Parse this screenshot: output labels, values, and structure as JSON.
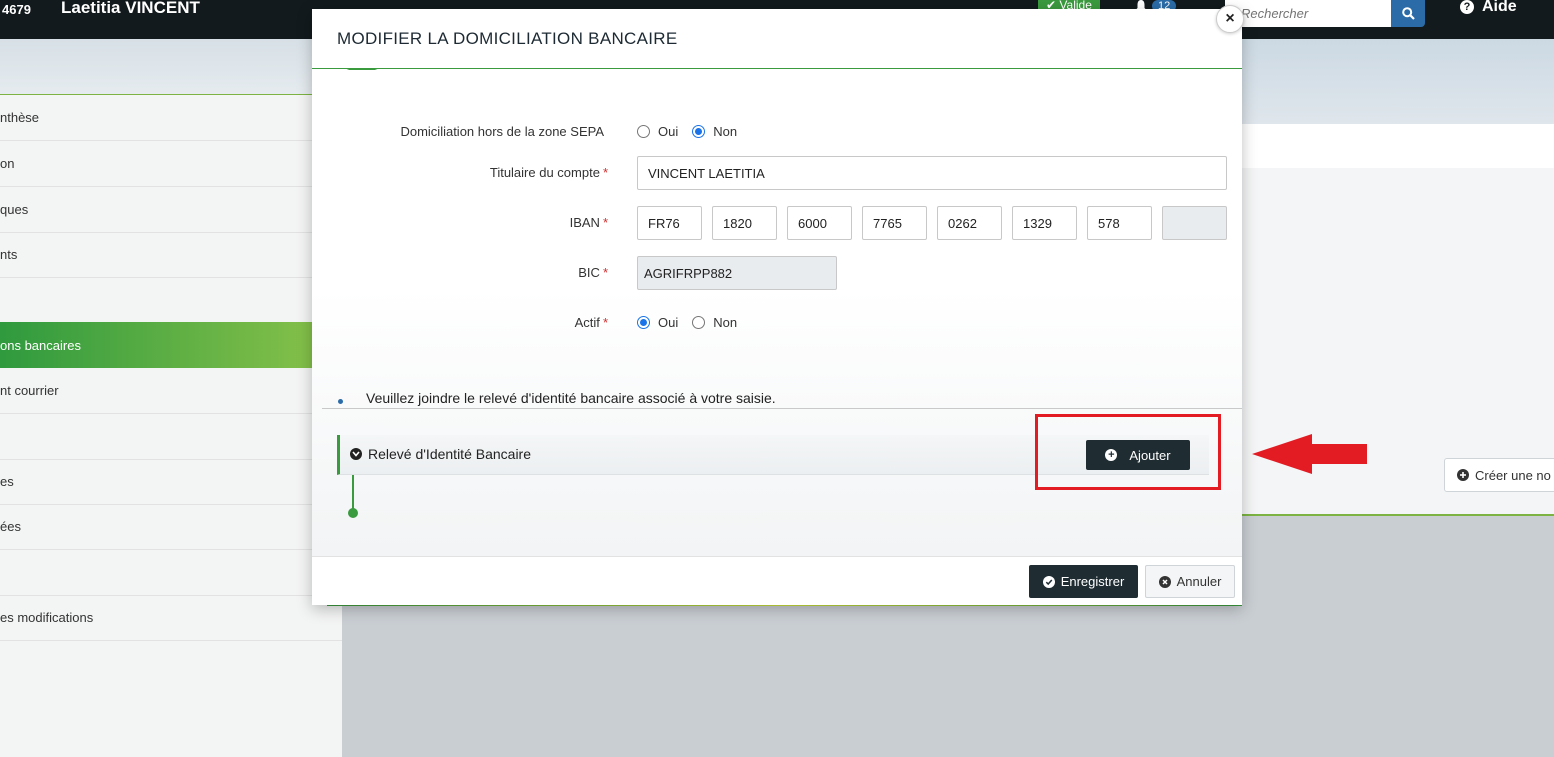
{
  "topbar": {
    "user_id": "4679",
    "user_name": "Laetitia VINCENT",
    "status_badge": "Valide",
    "notification_count": "12",
    "search_placeholder": "Rechercher",
    "help_label": "Aide"
  },
  "sidebar": {
    "items": [
      {
        "label": "nthèse",
        "active": false
      },
      {
        "label": "on",
        "active": false
      },
      {
        "label": "ques",
        "active": false
      },
      {
        "label": "nts",
        "active": false
      },
      {
        "label": "",
        "active": false
      },
      {
        "label": "ons bancaires",
        "active": true
      },
      {
        "label": "nt courrier",
        "active": false
      },
      {
        "label": "",
        "active": false
      },
      {
        "label": "es",
        "active": false
      },
      {
        "label": "ées",
        "active": false
      },
      {
        "label": "",
        "active": false
      },
      {
        "label": "es modifications",
        "active": false
      }
    ]
  },
  "background": {
    "create_button_label": "Créer une no"
  },
  "modal": {
    "title": "MODIFIER LA DOMICILIATION BANCAIRE",
    "close_label": "×",
    "fields": {
      "sepa": {
        "label": "Domiciliation hors de la zone SEPA",
        "options": [
          "Oui",
          "Non"
        ],
        "selected": "Non"
      },
      "holder": {
        "label": "Titulaire du compte",
        "value": "VINCENT LAETITIA"
      },
      "iban": {
        "label": "IBAN",
        "parts": [
          "FR76",
          "1820",
          "6000",
          "7765",
          "0262",
          "1329",
          "578",
          ""
        ]
      },
      "bic": {
        "label": "BIC",
        "value": "AGRIFRPP882"
      },
      "active": {
        "label": "Actif",
        "options": [
          "Oui",
          "Non"
        ],
        "selected": "Oui"
      }
    },
    "required_marker": "*",
    "info_message": "Veuillez joindre le relevé d'identité bancaire associé à votre saisie.",
    "rib_section": {
      "title": "Relevé d'Identité Bancaire",
      "add_label": "Ajouter"
    },
    "footer": {
      "save_label": "Enregistrer",
      "cancel_label": "Annuler"
    }
  },
  "colors": {
    "accent_green": "#3a9a3e",
    "dark_button": "#1f2d33",
    "annotation_red": "#e31b23",
    "primary_blue": "#2b6ca8"
  }
}
